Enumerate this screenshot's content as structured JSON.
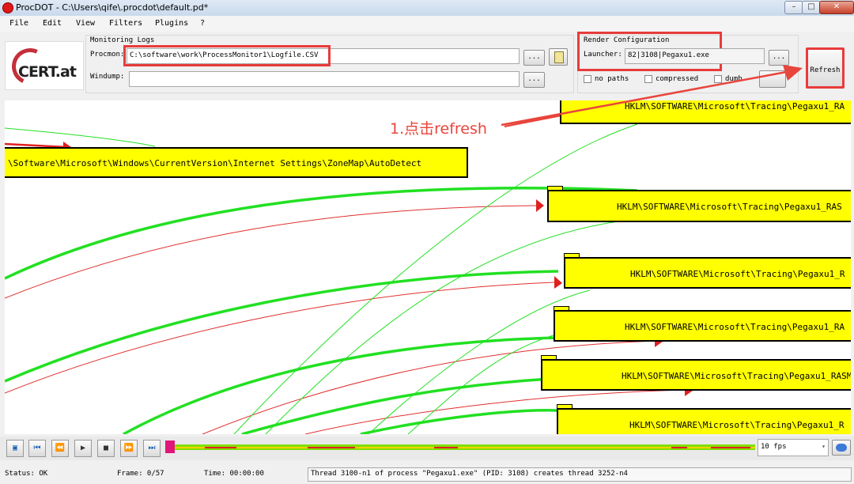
{
  "window": {
    "title": "ProcDOT - C:\\Users\\qife\\.procdot\\default.pd*",
    "minimize": "–",
    "maximize": "□",
    "close": "✕"
  },
  "menu": [
    "File",
    "Edit",
    "View",
    "Filters",
    "Plugins",
    "?"
  ],
  "logo": {
    "text": "CERT.at",
    "accent": "#c4303a"
  },
  "monitoring": {
    "group_label": "Monitoring Logs",
    "procmon_label": "Procmon:",
    "procmon_value": "C:\\software\\work\\ProcessMonitor1\\Logfile.CSV",
    "windump_label": "Windump:",
    "windump_value": "",
    "browse_label": "...",
    "highlight_color": "#e83b3b"
  },
  "render": {
    "group_label": "Render Configuration",
    "launcher_label": "Launcher:",
    "launcher_value": "82|3108|Pegaxu1.exe",
    "browse_label": "...",
    "options": [
      {
        "label": "no paths",
        "checked": false
      },
      {
        "label": "compressed",
        "checked": false
      },
      {
        "label": "dumb",
        "checked": false
      }
    ]
  },
  "refresh_label": "Refresh",
  "annotation": "1.点击refresh",
  "graph": {
    "node_fill": "#ffff00",
    "edge_primary": "#22e022",
    "edge_secondary": "#e03030",
    "nodes": [
      "HKLM\\SOFTWARE\\Microsoft\\Tracing\\Pegaxu1_RA",
      "\\Software\\Microsoft\\Windows\\CurrentVersion\\Internet Settings\\ZoneMap\\AutoDetect",
      "HKLM\\SOFTWARE\\Microsoft\\Tracing\\Pegaxu1_RAS",
      "HKLM\\SOFTWARE\\Microsoft\\Tracing\\Pegaxu1_R",
      "HKLM\\SOFTWARE\\Microsoft\\Tracing\\Pegaxu1_RA",
      "HKLM\\SOFTWARE\\Microsoft\\Tracing\\Pegaxu1_RASM",
      "HKLM\\SOFTWARE\\Microsoft\\Tracing\\Pegaxu1_R"
    ]
  },
  "playback": {
    "controls": [
      "film-icon",
      "skip-start-icon",
      "rewind-icon",
      "play-icon",
      "stop-icon",
      "forward-icon",
      "skip-end-icon"
    ],
    "fps": "10 fps",
    "timeline_colors": {
      "base": "#7fe000",
      "marker": "#e62020",
      "cursor": "#e0167a"
    }
  },
  "status": {
    "status_text": "Status: OK",
    "frame_text": "Frame: 0/57",
    "time_text": "Time: 00:00:00",
    "message": "Thread 3100-n1 of process \"Pegaxu1.exe\" (PID: 3108) creates thread 3252-n4"
  }
}
